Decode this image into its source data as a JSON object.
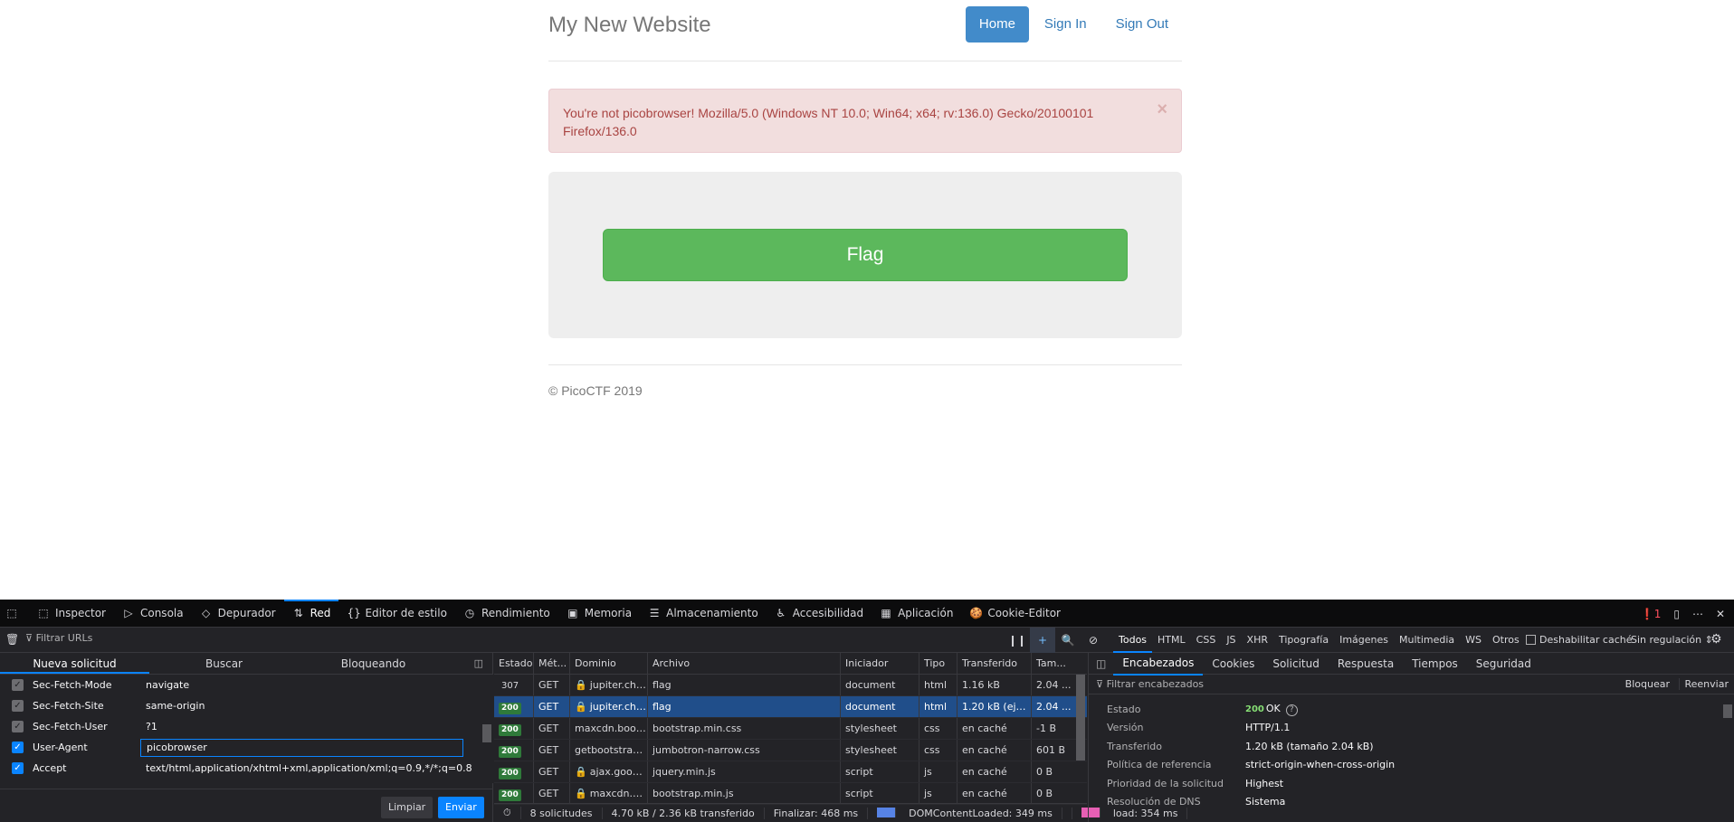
{
  "site": {
    "brand": "My New Website",
    "nav": [
      "Home",
      "Sign In",
      "Sign Out"
    ],
    "alert": "You're not picobrowser! Mozilla/5.0 (Windows NT 10.0; Win64; x64; rv:136.0) Gecko/20100101 Firefox/136.0",
    "alert_close": "×",
    "flag_label": "Flag",
    "footer": "© PicoCTF 2019"
  },
  "devtools": {
    "tabs": [
      {
        "icon": "⬚",
        "label": "Inspector"
      },
      {
        "icon": "▷",
        "label": "Consola"
      },
      {
        "icon": "◇",
        "label": "Depurador"
      },
      {
        "icon": "⇅",
        "label": "Red"
      },
      {
        "icon": "{}",
        "label": "Editor de estilo"
      },
      {
        "icon": "◷",
        "label": "Rendimiento"
      },
      {
        "icon": "▣",
        "label": "Memoria"
      },
      {
        "icon": "☰",
        "label": "Almacenamiento"
      },
      {
        "icon": "♿",
        "label": "Accesibilidad"
      },
      {
        "icon": "▦",
        "label": "Aplicación"
      },
      {
        "icon": "🍪",
        "label": "Cookie-Editor"
      }
    ],
    "error_count": "1",
    "filter_placeholder": "Filtrar URLs",
    "type_filters": [
      "Todos",
      "HTML",
      "CSS",
      "JS",
      "XHR",
      "Tipografía",
      "Imágenes",
      "Multimedia",
      "WS",
      "Otros"
    ],
    "disable_cache": "Deshabilitar caché",
    "throttling": "Sin regulación ⇕",
    "left_tabs": [
      "Nueva solicitud",
      "Buscar",
      "Bloqueando"
    ],
    "headers": [
      {
        "name": "Sec-Fetch-Mode",
        "value": "navigate",
        "checked": "partial"
      },
      {
        "name": "Sec-Fetch-Site",
        "value": "same-origin",
        "checked": "partial"
      },
      {
        "name": "Sec-Fetch-User",
        "value": "?1",
        "checked": "partial"
      },
      {
        "name": "User-Agent",
        "value": "picobrowser",
        "checked": "on"
      },
      {
        "name": "Accept",
        "value": "text/html,application/xhtml+xml,application/xml;q=0.9,*/*;q=0.8",
        "checked": "on"
      }
    ],
    "btn_clear": "Limpiar",
    "btn_send": "Enviar",
    "columns": [
      "Estado",
      "Mét...",
      "Dominio",
      "Archivo",
      "Iniciador",
      "Tipo",
      "Transferido",
      "Tam..."
    ],
    "requests": [
      {
        "status": "307",
        "method": "GET",
        "domain": "jupiter.cha...",
        "file": "flag",
        "initiator": "document",
        "type": "html",
        "transferred": "1.16 kB",
        "size": "2.04 ..."
      },
      {
        "status": "200",
        "method": "GET",
        "domain": "jupiter.cha...",
        "file": "flag",
        "initiator": "document",
        "type": "html",
        "transferred": "1.20 kB (ejecu...",
        "size": "2.04 ..."
      },
      {
        "status": "200",
        "method": "GET",
        "domain": "maxcdn.boots...",
        "file": "bootstrap.min.css",
        "initiator": "stylesheet",
        "type": "css",
        "transferred": "en caché",
        "size": "-1 B"
      },
      {
        "status": "200",
        "method": "GET",
        "domain": "getbootstrap....",
        "file": "jumbotron-narrow.css",
        "initiator": "stylesheet",
        "type": "css",
        "transferred": "en caché",
        "size": "601 B"
      },
      {
        "status": "200",
        "method": "GET",
        "domain": "ajax.googl...",
        "file": "jquery.min.js",
        "initiator": "script",
        "type": "js",
        "transferred": "en caché",
        "size": "0 B"
      },
      {
        "status": "200",
        "method": "GET",
        "domain": "maxcdn.b...",
        "file": "bootstrap.min.js",
        "initiator": "script",
        "type": "js",
        "transferred": "en caché",
        "size": "0 B"
      }
    ],
    "summary": {
      "requests": "8 solicitudes",
      "transferred": "4.70 kB / 2.36 kB transferido",
      "finish": "Finalizar: 468 ms",
      "dcl": "DOMContentLoaded: 349 ms",
      "load": "load: 354 ms"
    },
    "detail_tabs": [
      "Encabezados",
      "Cookies",
      "Solicitud",
      "Respuesta",
      "Tiempos",
      "Seguridad"
    ],
    "detail_filter": "Filtrar encabezados",
    "detail_actions": [
      "Bloquear",
      "Reenviar"
    ],
    "detail": [
      {
        "key": "Estado",
        "value": "OK",
        "code": "200"
      },
      {
        "key": "Versión",
        "value": "HTTP/1.1"
      },
      {
        "key": "Transferido",
        "value": "1.20 kB (tamaño 2.04 kB)"
      },
      {
        "key": "Política de referencia",
        "value": "strict-origin-when-cross-origin"
      },
      {
        "key": "Prioridad de la solicitud",
        "value": "Highest"
      },
      {
        "key": "Resolución de DNS",
        "value": "Sistema"
      }
    ],
    "colors": {
      "accent": "#0a84ff",
      "selected": "#204e8a",
      "ok": "#86de74",
      "dcl": "#5783e5",
      "load": "#e75fb4"
    }
  }
}
